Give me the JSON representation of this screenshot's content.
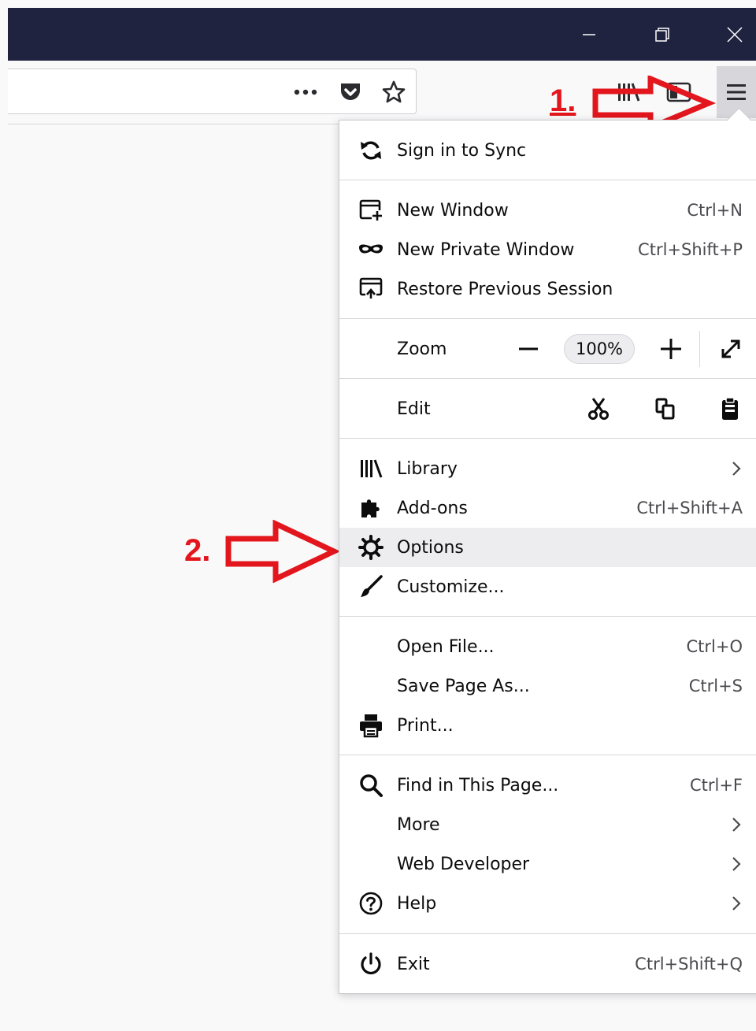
{
  "titlebar": {
    "minimize_icon": "minimize-icon",
    "restore_icon": "restore-icon",
    "close_icon": "close-icon"
  },
  "toolbar": {
    "page_actions_icon": "more-dots-icon",
    "pocket_icon": "pocket-icon",
    "bookmark_icon": "star-icon",
    "library_icon": "library-icon",
    "sidebar_icon": "sidebar-icon",
    "menu_icon": "hamburger-icon"
  },
  "annotations": {
    "step1": "1.",
    "step2": "2.",
    "color": "#e2161c"
  },
  "menu": {
    "sync": "Sign in to Sync",
    "new_window": {
      "label": "New Window",
      "shortcut": "Ctrl+N"
    },
    "new_private": {
      "label": "New Private Window",
      "shortcut": "Ctrl+Shift+P"
    },
    "restore_session": "Restore Previous Session",
    "zoom": {
      "label": "Zoom",
      "value": "100%"
    },
    "edit": {
      "label": "Edit"
    },
    "library": "Library",
    "addons": {
      "label": "Add-ons",
      "shortcut": "Ctrl+Shift+A"
    },
    "options": "Options",
    "customize": "Customize...",
    "open_file": {
      "label": "Open File...",
      "shortcut": "Ctrl+O"
    },
    "save_page": {
      "label": "Save Page As...",
      "shortcut": "Ctrl+S"
    },
    "print": "Print...",
    "find": {
      "label": "Find in This Page...",
      "shortcut": "Ctrl+F"
    },
    "more": "More",
    "web_developer": "Web Developer",
    "help": "Help",
    "exit": {
      "label": "Exit",
      "shortcut": "Ctrl+Shift+Q"
    }
  }
}
